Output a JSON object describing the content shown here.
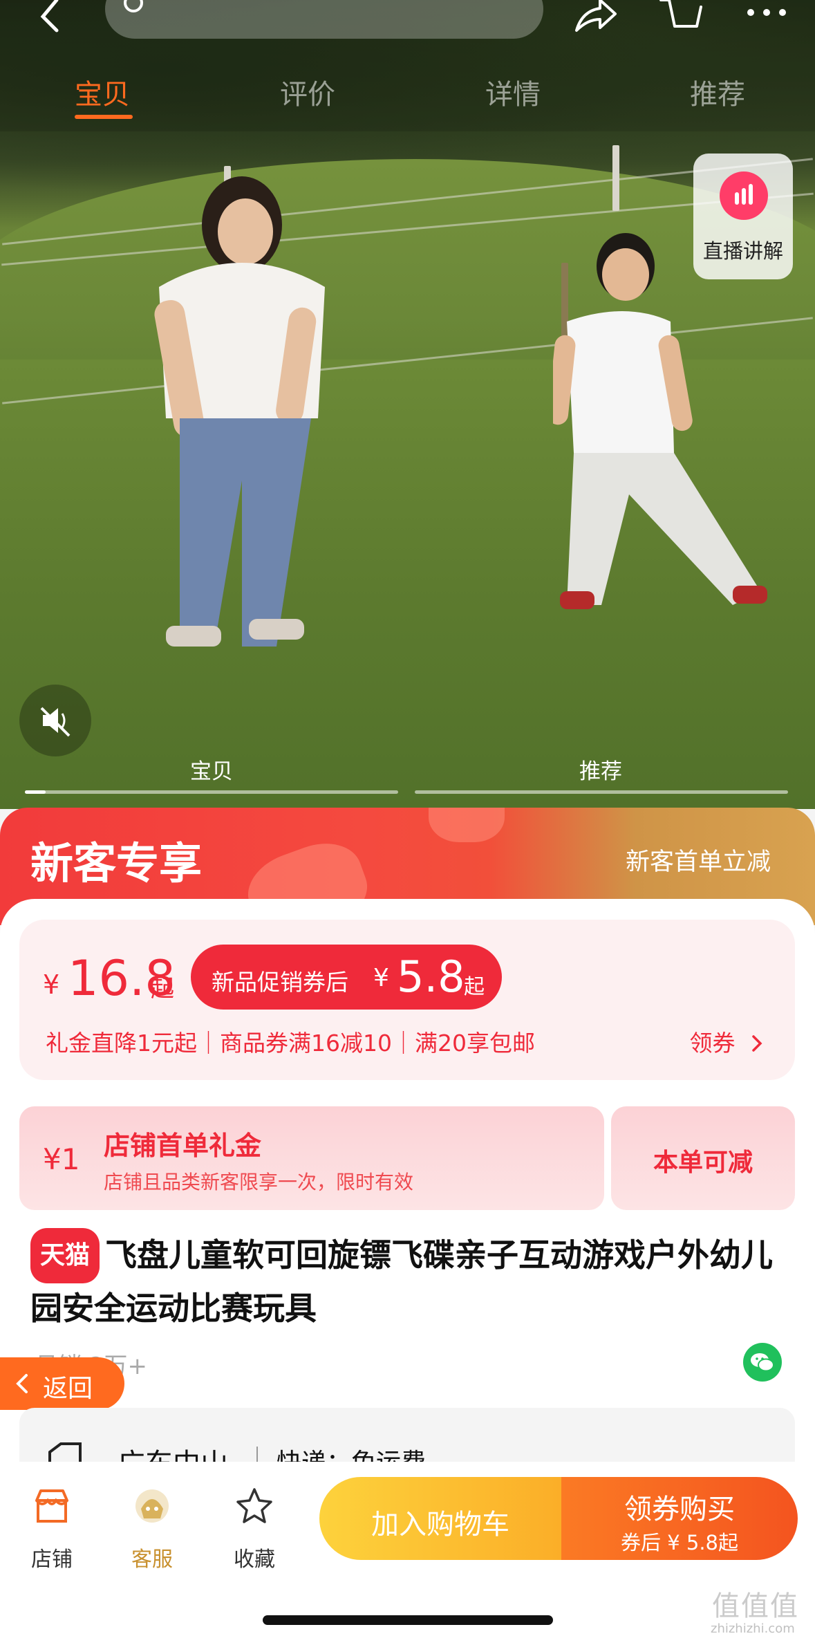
{
  "nav": {
    "tabs": [
      "宝贝",
      "评价",
      "详情",
      "推荐"
    ],
    "active_tab": "宝贝"
  },
  "live_badge": {
    "label": "直播讲解"
  },
  "media_tabs": [
    "宝贝",
    "推荐"
  ],
  "promo": {
    "title": "新客专享",
    "subtitle": "新客首单立减"
  },
  "price": {
    "currency": "¥",
    "value": "16.8",
    "suffix": "起",
    "coupon_label": "新品促销券后",
    "coupon_currency": "¥",
    "coupon_value": "5.8",
    "coupon_suffix": "起",
    "benefits": "礼金直降1元起｜商品券满16减10｜满20享包邮",
    "get_coupon": "领券"
  },
  "gift": {
    "amount": "¥1",
    "title": "店铺首单礼金",
    "desc": "店铺且品类新客限享一次，限时有效",
    "action": "本单可减"
  },
  "product": {
    "tag": "天猫",
    "title": "飞盘儿童软可回旋镖飞碟亲子互动游戏户外幼儿园安全运动比赛玩具",
    "sales": "月销 2万+"
  },
  "return_button": {
    "label": "返回"
  },
  "shipping": {
    "from": "广东中山",
    "fee": "快递：免运费"
  },
  "bottom_bar": {
    "store": "店铺",
    "service": "客服",
    "favorite": "收藏",
    "add_to_cart": "加入购物车",
    "buy": "领券购买",
    "buy_sub": "券后 ¥ 5.8起"
  },
  "watermark": {
    "text": "值值值",
    "url": "zhizhizhi.com"
  },
  "colors": {
    "accent_orange": "#ff6a1f",
    "price_red": "#ef2a3a",
    "cart_yellow": "#fdd23c",
    "buy_orange": "#f4541f",
    "wechat_green": "#20c05c"
  }
}
